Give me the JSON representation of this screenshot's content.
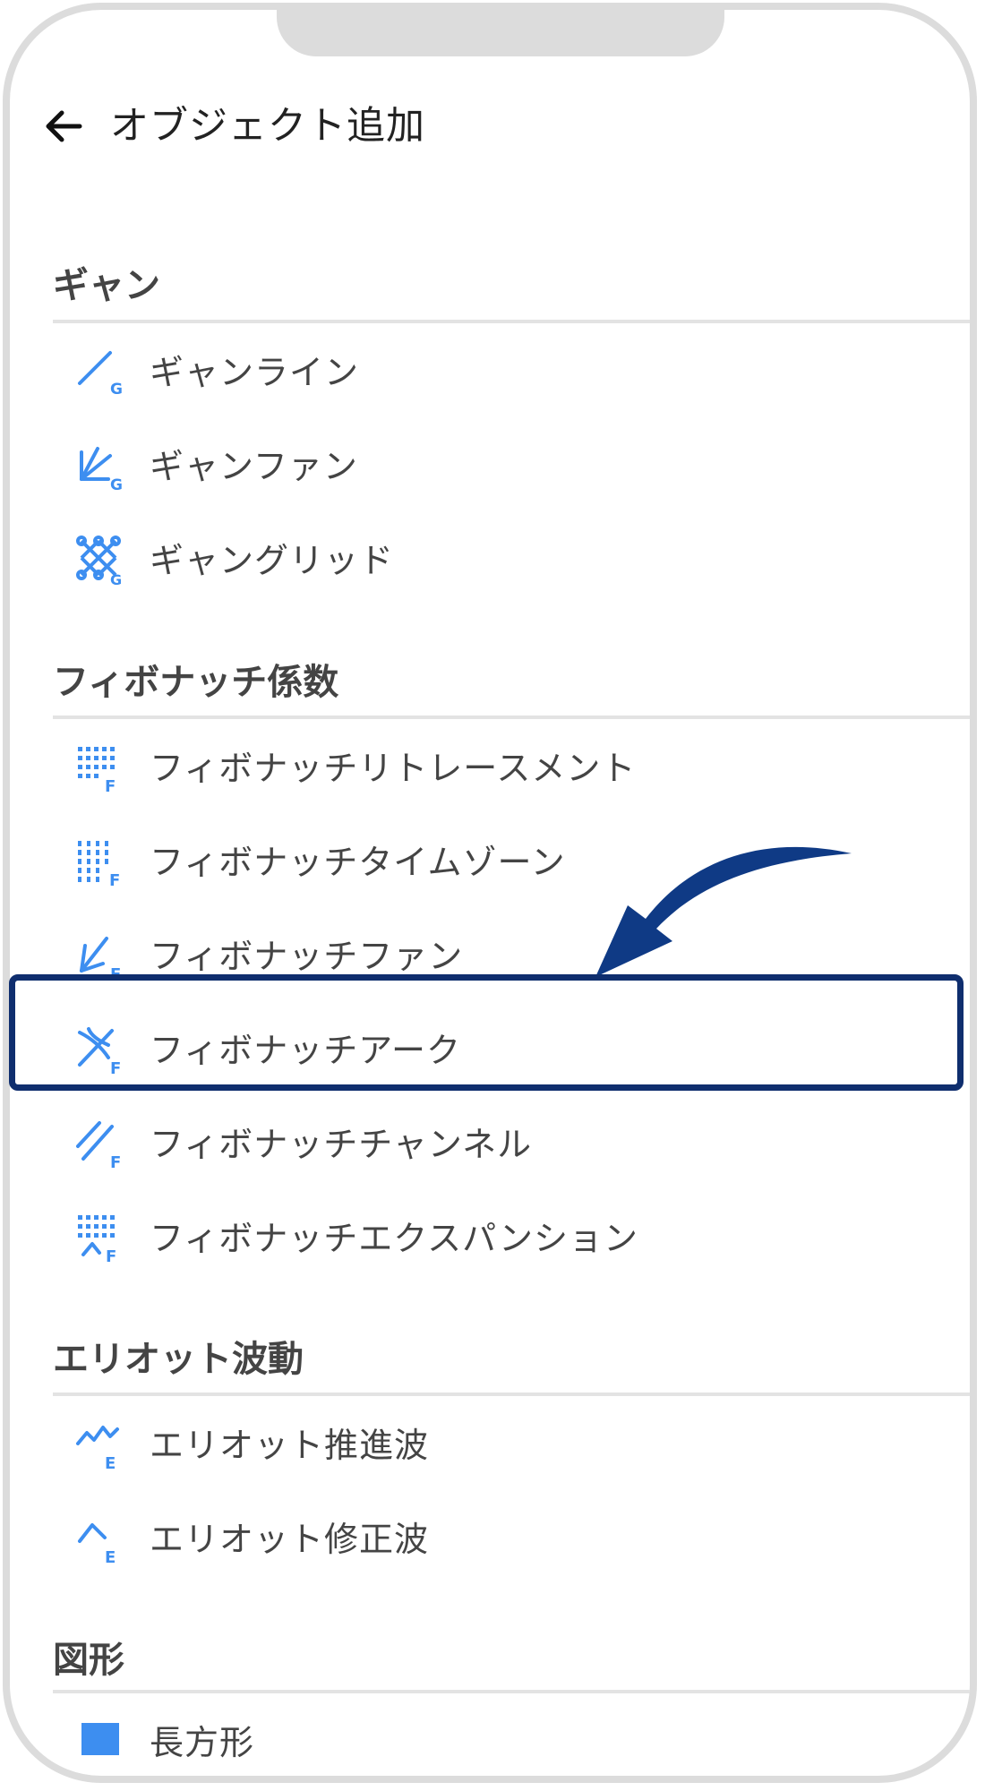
{
  "header": {
    "title": "オブジェクト追加",
    "back_icon": "arrow-left-icon"
  },
  "sections": [
    {
      "title": "ギャン",
      "items": [
        {
          "label": "ギャンライン",
          "icon": "gann-line-icon"
        },
        {
          "label": "ギャンファン",
          "icon": "gann-fan-icon"
        },
        {
          "label": "ギャングリッド",
          "icon": "gann-grid-icon"
        }
      ]
    },
    {
      "title": "フィボナッチ係数",
      "items": [
        {
          "label": "フィボナッチリトレースメント",
          "icon": "fib-retracement-icon"
        },
        {
          "label": "フィボナッチタイムゾーン",
          "icon": "fib-timezone-icon"
        },
        {
          "label": "フィボナッチファン",
          "icon": "fib-fan-icon"
        },
        {
          "label": "フィボナッチアーク",
          "icon": "fib-arc-icon"
        },
        {
          "label": "フィボナッチチャンネル",
          "icon": "fib-channel-icon"
        },
        {
          "label": "フィボナッチエクスパンション",
          "icon": "fib-expansion-icon"
        }
      ]
    },
    {
      "title": "エリオット波動",
      "items": [
        {
          "label": "エリオット推進波",
          "icon": "elliott-impulse-icon"
        },
        {
          "label": "エリオット修正波",
          "icon": "elliott-correction-icon"
        }
      ]
    },
    {
      "title": "図形",
      "items": [
        {
          "label": "長方形",
          "icon": "rectangle-icon"
        }
      ]
    }
  ],
  "colors": {
    "icon_blue": "#3d8ef0",
    "highlight": "#0f2e6e",
    "arrow": "#0f3a85"
  }
}
